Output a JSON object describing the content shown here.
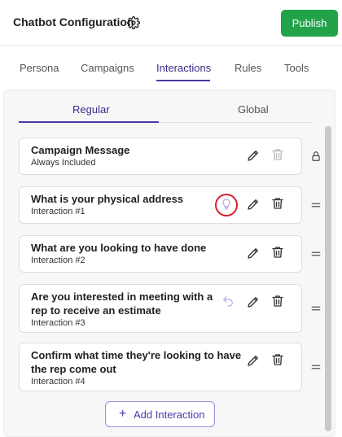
{
  "header": {
    "title": "Chatbot Configuration",
    "settings_icon": "gear-icon",
    "publish_label": "Publish",
    "publish_color": "#22a34a"
  },
  "tabs": [
    {
      "label": "Persona",
      "active": false
    },
    {
      "label": "Campaigns",
      "active": false
    },
    {
      "label": "Interactions",
      "active": true
    },
    {
      "label": "Rules",
      "active": false
    },
    {
      "label": "Tools",
      "active": false
    }
  ],
  "subtabs": [
    {
      "label": "Regular",
      "active": true
    },
    {
      "label": "Global",
      "active": false
    }
  ],
  "accent_color": "#4b3aa8",
  "interactions": [
    {
      "title_lines": [
        "Campaign Message"
      ],
      "subtitle": "Always Included",
      "side_icon": "lock-icon",
      "delete_disabled": true
    },
    {
      "title_lines": [
        "What is your physical address"
      ],
      "subtitle": "Interaction #1",
      "extra_icon": "lightbulb-icon",
      "highlighted": true,
      "side_icon": "drag-handle-icon"
    },
    {
      "title_lines": [
        "What are you looking to have done"
      ],
      "subtitle": "Interaction #2",
      "side_icon": "drag-handle-icon"
    },
    {
      "title_lines": [
        "Are you interested in meeting with a",
        "rep to receive an estimate"
      ],
      "subtitle": "Interaction #3",
      "extra_icon": "undo-icon",
      "side_icon": "drag-handle-icon"
    },
    {
      "title_lines": [
        "Confirm what time they're looking to have",
        "the rep come out"
      ],
      "subtitle": "Interaction #4",
      "side_icon": "drag-handle-icon"
    }
  ],
  "add_button": {
    "label": "Add Interaction",
    "icon": "plus-icon"
  }
}
